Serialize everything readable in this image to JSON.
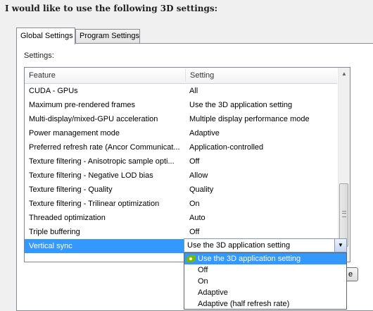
{
  "heading": "I would like to use the following 3D settings:",
  "tabs": [
    {
      "label": "Global Settings",
      "active": true
    },
    {
      "label": "Program Settings",
      "active": false
    }
  ],
  "settings_label": "Settings:",
  "table": {
    "columns": [
      "Feature",
      "Setting"
    ],
    "rows": [
      {
        "feature": "CUDA - GPUs",
        "setting": "All"
      },
      {
        "feature": "Maximum pre-rendered frames",
        "setting": "Use the 3D application setting"
      },
      {
        "feature": "Multi-display/mixed-GPU acceleration",
        "setting": "Multiple display performance mode"
      },
      {
        "feature": "Power management mode",
        "setting": "Adaptive"
      },
      {
        "feature": "Preferred refresh rate (Ancor Communicat...",
        "setting": "Application-controlled"
      },
      {
        "feature": "Texture filtering - Anisotropic sample opti...",
        "setting": "Off"
      },
      {
        "feature": "Texture filtering - Negative LOD bias",
        "setting": "Allow"
      },
      {
        "feature": "Texture filtering - Quality",
        "setting": "Quality"
      },
      {
        "feature": "Texture filtering - Trilinear optimization",
        "setting": "On"
      },
      {
        "feature": "Threaded optimization",
        "setting": "Auto"
      },
      {
        "feature": "Triple buffering",
        "setting": "Off"
      },
      {
        "feature": "Vertical sync",
        "setting": "Use the 3D application setting",
        "selected": true
      }
    ]
  },
  "combo": {
    "value": "Use the 3D application setting",
    "options": [
      {
        "label": "Use the 3D application setting",
        "highlighted": true
      },
      {
        "label": "Off"
      },
      {
        "label": "On"
      },
      {
        "label": "Adaptive"
      },
      {
        "label": "Adaptive (half refresh rate)"
      }
    ]
  },
  "partial_button": "e",
  "colors": {
    "selection": "#3399ff",
    "nvidia_icon": "#76b900"
  },
  "icons": {
    "scroll_up": "arrow-up-icon",
    "scroll_down": "arrow-down-icon",
    "combo": "chevron-down-icon",
    "option": "nvidia-logo-icon"
  }
}
